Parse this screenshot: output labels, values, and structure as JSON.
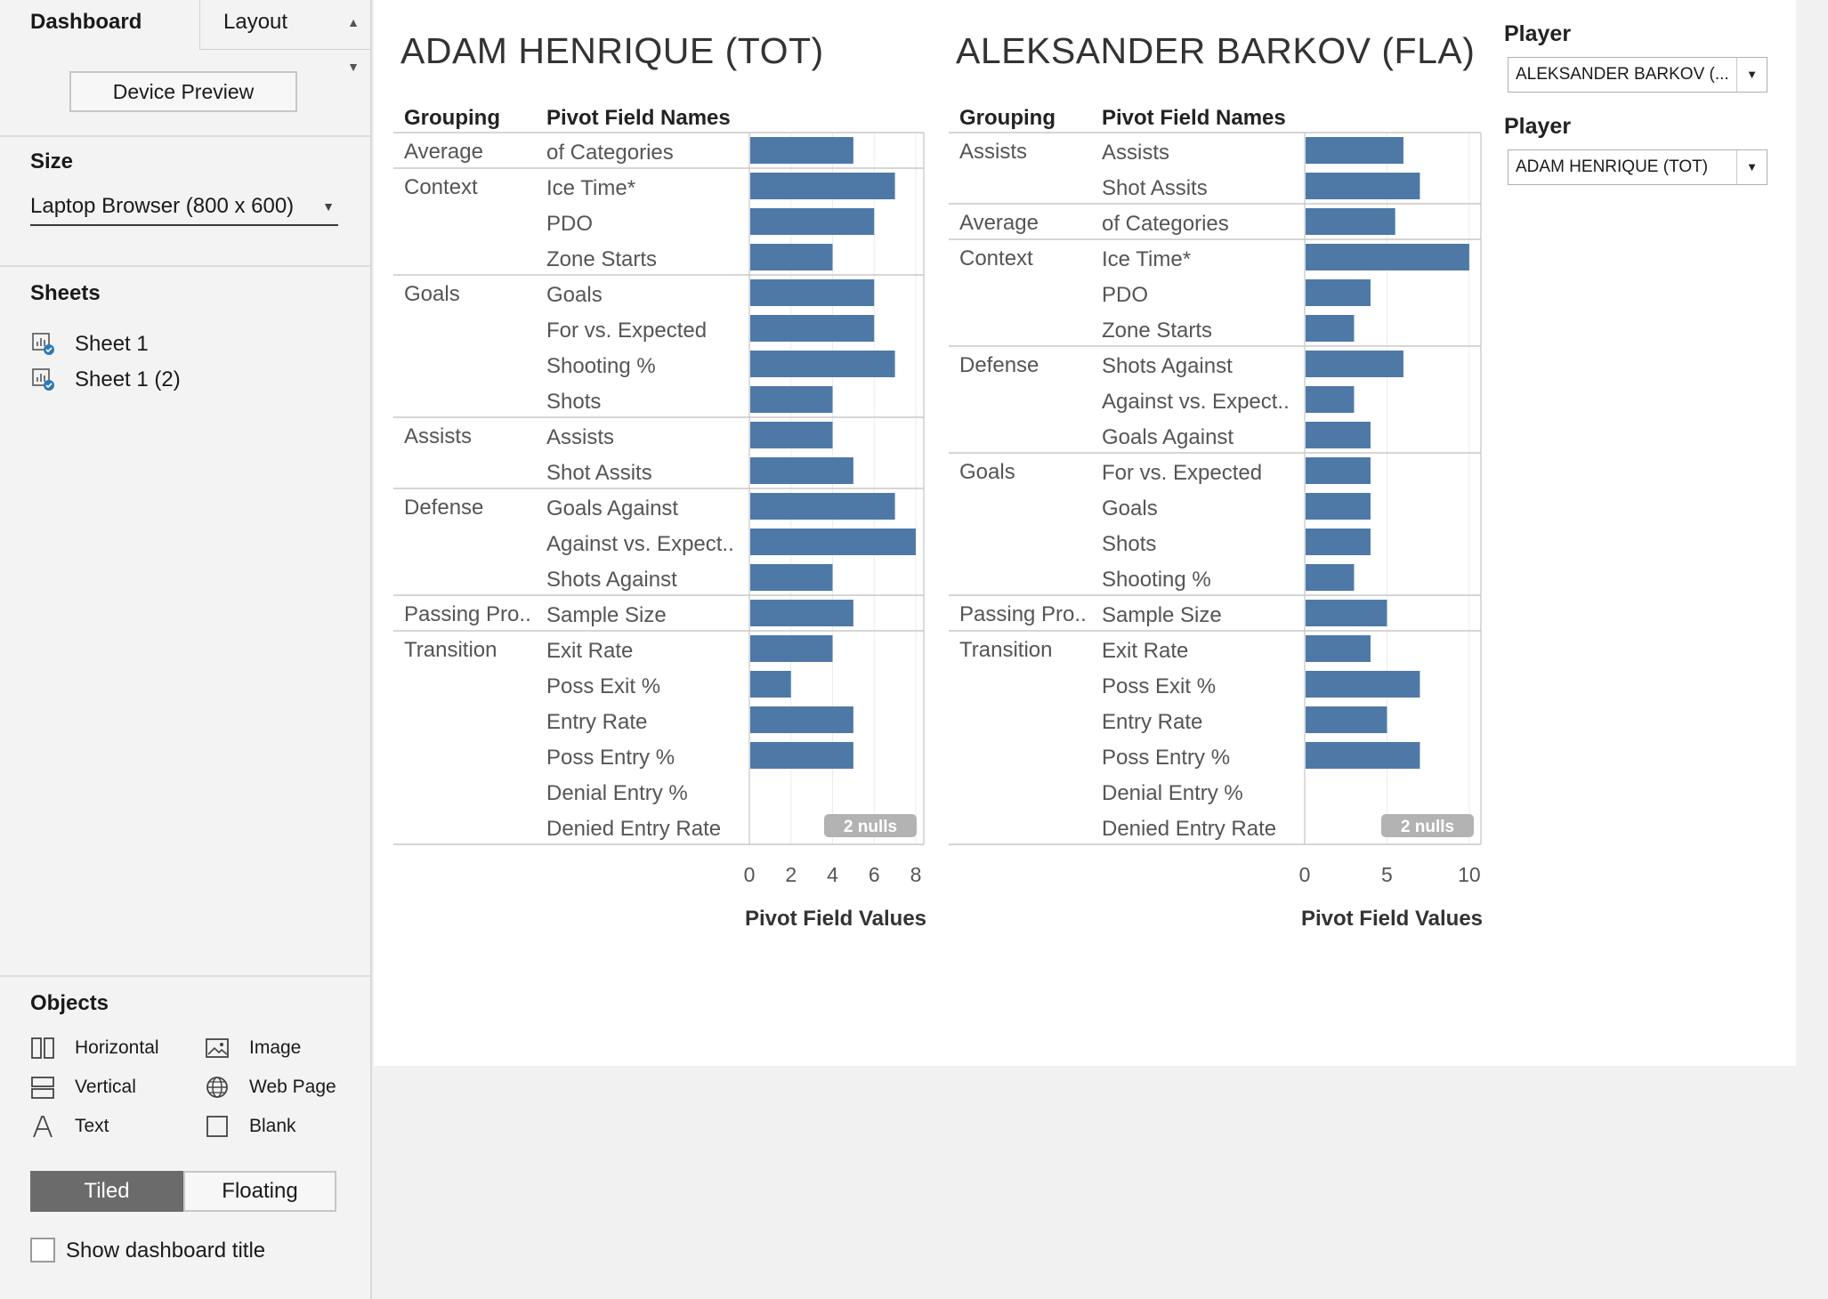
{
  "left_panel": {
    "tabs": {
      "dashboard": "Dashboard",
      "layout": "Layout"
    },
    "device_preview": "Device Preview",
    "size": {
      "title": "Size",
      "selected": "Laptop Browser (800 x 600)"
    },
    "sheets": {
      "title": "Sheets",
      "items": [
        "Sheet 1",
        "Sheet 1 (2)"
      ]
    },
    "objects": {
      "title": "Objects",
      "items": {
        "horizontal": "Horizontal",
        "image": "Image",
        "vertical": "Vertical",
        "web_page": "Web Page",
        "text": "Text",
        "blank": "Blank"
      },
      "tiled": "Tiled",
      "floating": "Floating",
      "show_title": "Show dashboard title",
      "show_title_checked": false
    }
  },
  "filters": {
    "player1": {
      "label": "Player",
      "value": "ALEKSANDER BARKOV (..."
    },
    "player2": {
      "label": "Player",
      "value": "ADAM HENRIQUE (TOT)"
    }
  },
  "charts": [
    {
      "title": "ADAM HENRIQUE (TOT)"
    },
    {
      "title": "ALEKSANDER BARKOV (FLA)"
    }
  ],
  "chart_data": [
    {
      "type": "bar",
      "orientation": "horizontal",
      "title": "ADAM HENRIQUE (TOT)",
      "row_headers": [
        "Grouping",
        "Pivot Field Names"
      ],
      "xlabel": "Pivot Field Values",
      "xticks": [
        0,
        2,
        4,
        6,
        8
      ],
      "xlim": [
        0,
        8.3
      ],
      "bar_color": "#4e79a7",
      "null_note": "2 nulls",
      "groups": [
        {
          "name": "Average",
          "rows": [
            {
              "label": "of Categories",
              "value": 5
            }
          ]
        },
        {
          "name": "Context",
          "rows": [
            {
              "label": "Ice Time*",
              "value": 7
            },
            {
              "label": "PDO",
              "value": 6
            },
            {
              "label": "Zone Starts",
              "value": 4
            }
          ]
        },
        {
          "name": "Goals",
          "rows": [
            {
              "label": "Goals",
              "value": 6
            },
            {
              "label": "For vs. Expected",
              "value": 6
            },
            {
              "label": "Shooting %",
              "value": 7
            },
            {
              "label": "Shots",
              "value": 4
            }
          ]
        },
        {
          "name": "Assists",
          "rows": [
            {
              "label": "Assists",
              "value": 4
            },
            {
              "label": "Shot Assits",
              "value": 5
            }
          ]
        },
        {
          "name": "Defense",
          "rows": [
            {
              "label": "Goals Against",
              "value": 7
            },
            {
              "label": "Against vs. Expect..",
              "value": 8
            },
            {
              "label": "Shots Against",
              "value": 4
            }
          ]
        },
        {
          "name": "Passing Pro..",
          "rows": [
            {
              "label": "Sample Size",
              "value": 5
            }
          ]
        },
        {
          "name": "Transition",
          "rows": [
            {
              "label": "Exit Rate",
              "value": 4
            },
            {
              "label": "Poss Exit %",
              "value": 2
            },
            {
              "label": "Entry Rate",
              "value": 5
            },
            {
              "label": "Poss Entry %",
              "value": 5
            },
            {
              "label": "Denial Entry %",
              "value": null
            },
            {
              "label": "Denied Entry Rate",
              "value": null
            }
          ]
        }
      ]
    },
    {
      "type": "bar",
      "orientation": "horizontal",
      "title": "ALEKSANDER BARKOV (FLA)",
      "row_headers": [
        "Grouping",
        "Pivot Field Names"
      ],
      "xlabel": "Pivot Field Values",
      "xticks": [
        0,
        5,
        10
      ],
      "xlim": [
        0,
        10.6
      ],
      "bar_color": "#4e79a7",
      "null_note": "2 nulls",
      "groups": [
        {
          "name": "Assists",
          "rows": [
            {
              "label": "Assists",
              "value": 6
            },
            {
              "label": "Shot Assits",
              "value": 7
            }
          ]
        },
        {
          "name": "Average",
          "rows": [
            {
              "label": "of Categories",
              "value": 5.5
            }
          ]
        },
        {
          "name": "Context",
          "rows": [
            {
              "label": "Ice Time*",
              "value": 10
            },
            {
              "label": "PDO",
              "value": 4
            },
            {
              "label": "Zone Starts",
              "value": 3
            }
          ]
        },
        {
          "name": "Defense",
          "rows": [
            {
              "label": "Shots Against",
              "value": 6
            },
            {
              "label": "Against vs. Expect..",
              "value": 3
            },
            {
              "label": "Goals Against",
              "value": 4
            }
          ]
        },
        {
          "name": "Goals",
          "rows": [
            {
              "label": "For vs. Expected",
              "value": 4
            },
            {
              "label": "Goals",
              "value": 4
            },
            {
              "label": "Shots",
              "value": 4
            },
            {
              "label": "Shooting %",
              "value": 3
            }
          ]
        },
        {
          "name": "Passing Pro..",
          "rows": [
            {
              "label": "Sample Size",
              "value": 5
            }
          ]
        },
        {
          "name": "Transition",
          "rows": [
            {
              "label": "Exit Rate",
              "value": 4
            },
            {
              "label": "Poss Exit %",
              "value": 7
            },
            {
              "label": "Entry Rate",
              "value": 5
            },
            {
              "label": "Poss Entry %",
              "value": 7
            },
            {
              "label": "Denial Entry %",
              "value": null
            },
            {
              "label": "Denied Entry Rate",
              "value": null
            }
          ]
        }
      ]
    }
  ]
}
